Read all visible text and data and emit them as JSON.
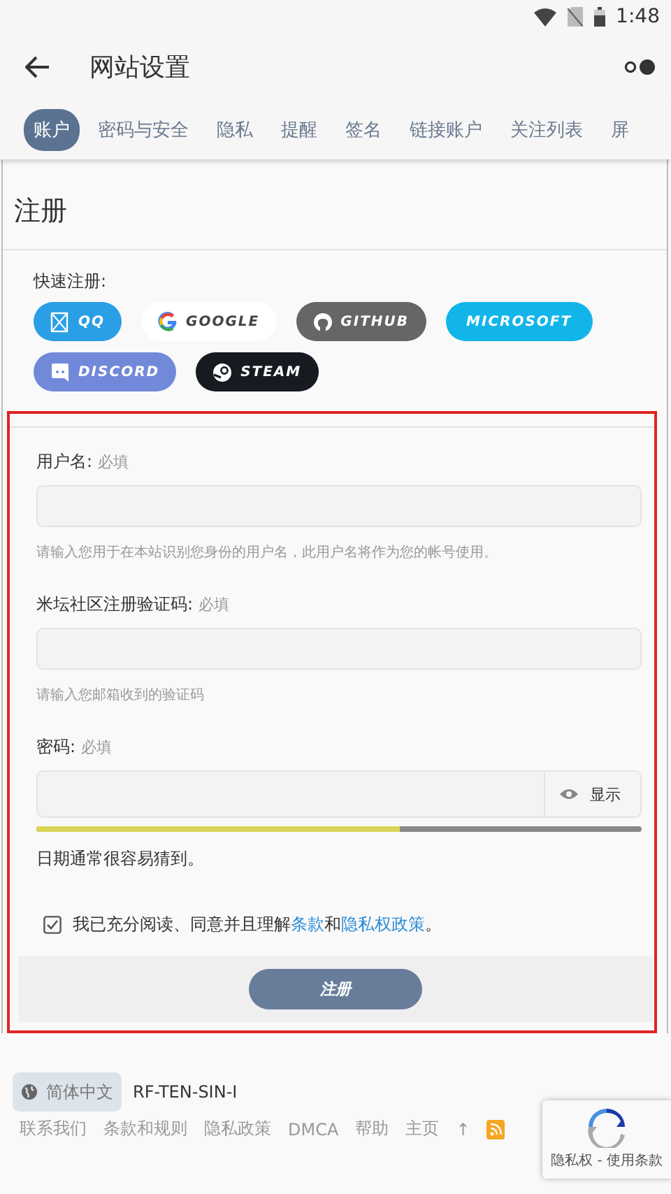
{
  "status_bar": {
    "time": "1:48"
  },
  "app_bar": {
    "title": "网站设置"
  },
  "tabs": [
    {
      "label": "账户",
      "selected": true
    },
    {
      "label": "密码与安全",
      "selected": false
    },
    {
      "label": "隐私",
      "selected": false
    },
    {
      "label": "提醒",
      "selected": false
    },
    {
      "label": "签名",
      "selected": false
    },
    {
      "label": "链接账户",
      "selected": false
    },
    {
      "label": "关注列表",
      "selected": false
    },
    {
      "label": "屏",
      "selected": false
    }
  ],
  "page_title": "注册",
  "quick_register": {
    "label": "快速注册:",
    "providers": [
      {
        "kind": "qq",
        "label": "QQ"
      },
      {
        "kind": "google",
        "label": "GOOGLE"
      },
      {
        "kind": "github",
        "label": "GITHUB"
      },
      {
        "kind": "microsoft",
        "label": "MICROSOFT"
      },
      {
        "kind": "discord",
        "label": "DISCORD"
      },
      {
        "kind": "steam",
        "label": "STEAM"
      }
    ]
  },
  "form": {
    "fields": [
      {
        "label": "用户名:",
        "required": "必填",
        "hint": "请输入您用于在本站识别您身份的用户名，此用户名将作为您的帐号使用。"
      },
      {
        "label": "米坛社区注册验证码:",
        "required": "必填",
        "hint": "请输入您邮箱收到的验证码"
      }
    ],
    "password": {
      "label": "密码:",
      "required": "必填",
      "toggle": "显示",
      "strength": {
        "level": 0.6
      },
      "feedback": "日期通常很容易猜到。"
    },
    "agreement": {
      "checked": true,
      "text": "我已充分阅读、同意并且理解",
      "terms": "条款",
      "and": "和",
      "privacy": "隐私权政策",
      "end": "。"
    },
    "submit": "注册"
  },
  "footer": {
    "language": "简体中文",
    "server": "RF-TEN-SIN-I",
    "links": [
      "联系我们",
      "条款和规则",
      "隐私政策",
      "DMCA",
      "帮助",
      "主页",
      "↑"
    ],
    "recaptcha": "隐私权 - 使用条款"
  }
}
